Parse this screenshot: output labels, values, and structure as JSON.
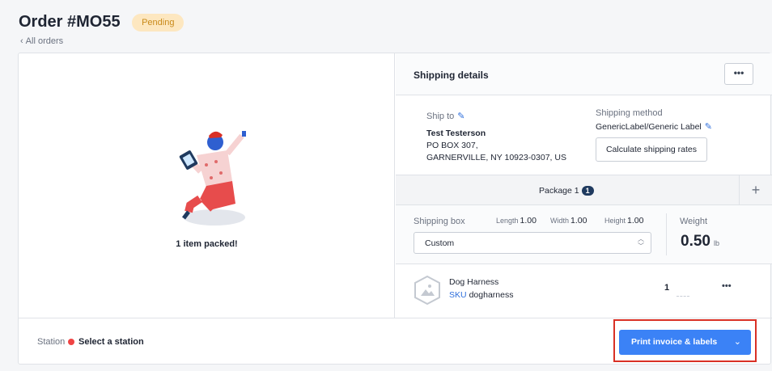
{
  "header": {
    "title": "Order #MO55",
    "status": "Pending",
    "back_link": "All orders"
  },
  "left": {
    "packed_message": "1 item packed!"
  },
  "shipping": {
    "title": "Shipping details",
    "more": "•••",
    "ship_to_label": "Ship to",
    "name": "Test Testerson",
    "address_line1": "PO BOX 307,",
    "address_line2": "GARNERVILLE, NY 10923-0307, US",
    "method_label": "Shipping method",
    "method_value": "GenericLabel/Generic Label",
    "calc_button": "Calculate shipping rates"
  },
  "package": {
    "label": "Package 1",
    "count": "1",
    "add": "+",
    "box_label": "Shipping box",
    "length_label": "Length",
    "length": "1.00",
    "width_label": "Width",
    "width": "1.00",
    "height_label": "Height",
    "height": "1.00",
    "box_value": "Custom",
    "weight_label": "Weight",
    "weight_value": "0.50",
    "weight_unit": "lb"
  },
  "item": {
    "name": "Dog Harness",
    "sku_label": "SKU",
    "sku": "dogharness",
    "qty": "1",
    "more": "•••"
  },
  "footer": {
    "station_label": "Station",
    "station_value": "Select a station",
    "print_button": "Print invoice & labels"
  },
  "colors": {
    "accent": "#3b82f6",
    "badge_bg": "#fde7c0",
    "badge_text": "#c98a1a",
    "station_dot": "#ef4444",
    "highlight": "#d93025"
  }
}
